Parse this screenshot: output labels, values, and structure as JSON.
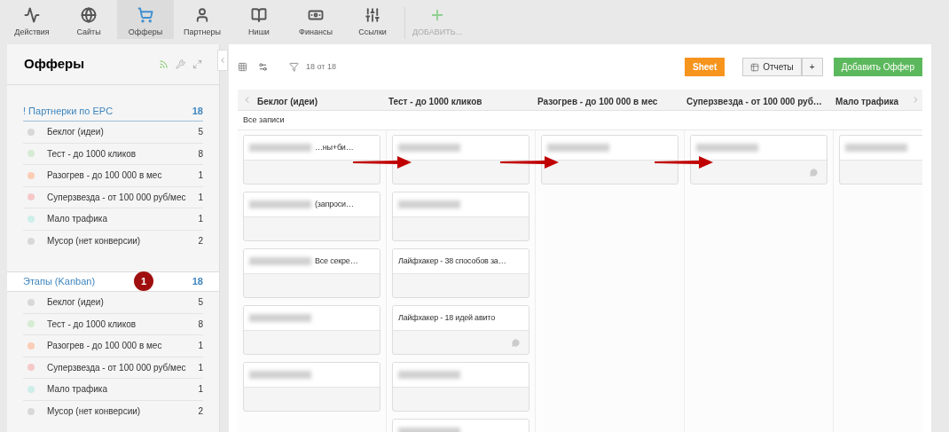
{
  "nav": [
    {
      "label": "Действия",
      "selected": false,
      "disabled": false
    },
    {
      "label": "Сайты",
      "selected": false,
      "disabled": false
    },
    {
      "label": "Офферы",
      "selected": true,
      "disabled": false
    },
    {
      "label": "Партнеры",
      "selected": false,
      "disabled": false
    },
    {
      "label": "Ниши",
      "selected": false,
      "disabled": false
    },
    {
      "label": "Финансы",
      "selected": false,
      "disabled": false
    },
    {
      "label": "Ссылки",
      "selected": false,
      "disabled": false
    },
    {
      "label": "ДОБАВИТЬ...",
      "selected": false,
      "disabled": true
    }
  ],
  "sidebar": {
    "title": "Офферы",
    "groups": [
      {
        "title": "! Партнерки по EPC",
        "count": "18",
        "selected": false,
        "items": [
          {
            "label": "Беклог (идеи)",
            "count": "5",
            "color": "#d8d8d8"
          },
          {
            "label": "Тест - до 1000 кликов",
            "count": "8",
            "color": "#d6ebd3"
          },
          {
            "label": "Разогрев - до 100 000 в мес",
            "count": "1",
            "color": "#fbcdb7"
          },
          {
            "label": "Суперзвезда - от 100 000 руб/мес",
            "count": "1",
            "color": "#f6c9c9"
          },
          {
            "label": "Мало трафика",
            "count": "1",
            "color": "#cdeee9"
          },
          {
            "label": "Мусор (нет конверсии)",
            "count": "2",
            "color": "#d8d8d8"
          }
        ]
      },
      {
        "title": "Этапы (Kanban)",
        "count": "18",
        "selected": true,
        "badge": "1",
        "items": [
          {
            "label": "Беклог (идеи)",
            "count": "5",
            "color": "#d8d8d8"
          },
          {
            "label": "Тест - до 1000 кликов",
            "count": "8",
            "color": "#d6ebd3"
          },
          {
            "label": "Разогрев - до 100 000 в мес",
            "count": "1",
            "color": "#fbcdb7"
          },
          {
            "label": "Суперзвезда - от 100 000 руб/мес",
            "count": "1",
            "color": "#f6c9c9"
          },
          {
            "label": "Мало трафика",
            "count": "1",
            "color": "#cdeee9"
          },
          {
            "label": "Мусор (нет конверсии)",
            "count": "2",
            "color": "#d8d8d8"
          }
        ]
      }
    ]
  },
  "toolbar": {
    "filter_count": "18 от 18",
    "buttons": [
      {
        "label": "Sheet",
        "kind": "orange"
      },
      {
        "label": "Отчеты",
        "kind": "report"
      },
      {
        "label": "+",
        "kind": "plain"
      },
      {
        "label": "Добавить Оффер",
        "kind": "green"
      }
    ]
  },
  "board": {
    "row_label": "Все записи",
    "columns": [
      {
        "title": "Беклог (идеи)",
        "cards": [
          {
            "title": "…ны+би…",
            "blurred": true,
            "comment": false
          },
          {
            "title": "(запроси…",
            "blurred": true,
            "comment": false
          },
          {
            "title": "Все секре…",
            "blurred": true,
            "comment": false
          },
          {
            "blurred": true,
            "comment": false
          },
          {
            "blurred": true,
            "comment": false
          }
        ]
      },
      {
        "title": "Тест - до 1000 кликов",
        "cards": [
          {
            "blurred": true,
            "comment": false
          },
          {
            "blurred": true,
            "comment": false
          },
          {
            "title": "Лайфхакер - 38 способов за…",
            "blurred": false,
            "comment": false
          },
          {
            "title": "Лайфхакер - 18 идей авито",
            "blurred": false,
            "comment": true
          },
          {
            "blurred": true,
            "comment": false
          },
          {
            "blurred": true,
            "comment": false
          }
        ]
      },
      {
        "title": "Разогрев - до 100 000 в мес",
        "cards": [
          {
            "blurred": true,
            "comment": false
          }
        ]
      },
      {
        "title": "Суперзвезда - от 100 000 руб…",
        "cards": [
          {
            "blurred": true,
            "comment": true
          }
        ]
      },
      {
        "title": "Мало трафика",
        "cards": [
          {
            "blurred": true
          }
        ]
      }
    ]
  }
}
